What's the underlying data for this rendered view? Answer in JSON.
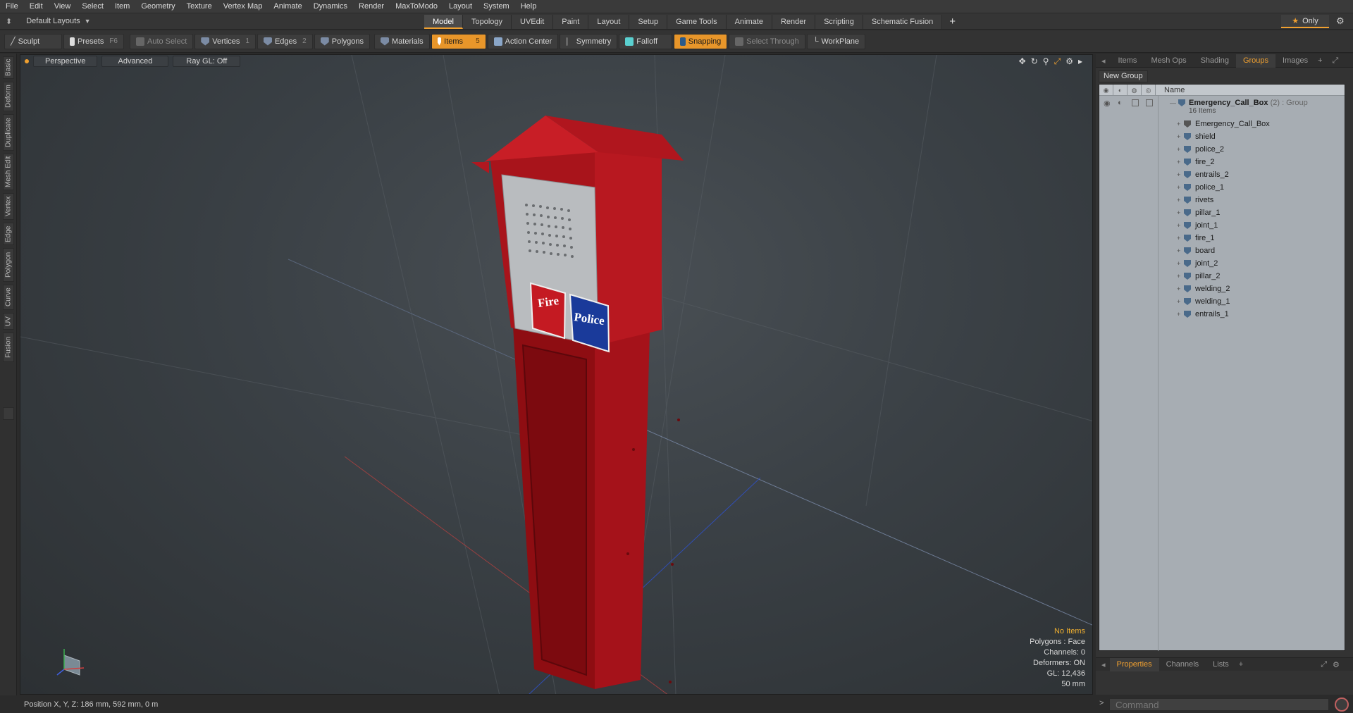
{
  "menu": [
    "File",
    "Edit",
    "View",
    "Select",
    "Item",
    "Geometry",
    "Texture",
    "Vertex Map",
    "Animate",
    "Dynamics",
    "Render",
    "MaxToModo",
    "Layout",
    "System",
    "Help"
  ],
  "layout": {
    "selector": "Default Layouts"
  },
  "tabs": [
    "Model",
    "Topology",
    "UVEdit",
    "Paint",
    "Layout",
    "Setup",
    "Game Tools",
    "Animate",
    "Render",
    "Scripting",
    "Schematic Fusion"
  ],
  "active_tab": "Model",
  "only_label": "Only",
  "toolbar": {
    "sculpt": "Sculpt",
    "presets": "Presets",
    "presets_key": "F6",
    "auto_select": "Auto Select",
    "vertices": "Vertices",
    "vertices_count": "1",
    "edges": "Edges",
    "edges_count": "2",
    "polygons": "Polygons",
    "materials": "Materials",
    "items": "Items",
    "items_count": "5",
    "action_center": "Action Center",
    "symmetry": "Symmetry",
    "falloff": "Falloff",
    "snapping": "Snapping",
    "select_through": "Select Through",
    "workplane": "WorkPlane"
  },
  "left_tabs": [
    "Basic",
    "Deform",
    "Duplicate",
    "Mesh Edit",
    "Vertex",
    "Edge",
    "Polygon",
    "Curve",
    "UV",
    "Fusion"
  ],
  "viewport": {
    "perspective": "Perspective",
    "advanced": "Advanced",
    "raygl": "Ray GL: Off",
    "sign_fire": "Fire",
    "sign_police": "Police",
    "info": {
      "no_items": "No Items",
      "polygons": "Polygons : Face",
      "channels": "Channels: 0",
      "deformers": "Deformers: ON",
      "gl": "GL: 12,436",
      "scale": "50 mm"
    }
  },
  "right_panel": {
    "tabs": [
      "Items",
      "Mesh Ops",
      "Shading",
      "Groups",
      "Images"
    ],
    "active_tab": "Groups",
    "new_group": "New Group",
    "name_header": "Name",
    "group_name": "Emergency_Call_Box",
    "group_suffix": "(2) : Group",
    "group_count": "16 Items",
    "items": [
      "Emergency_Call_Box",
      "shield",
      "police_2",
      "fire_2",
      "entrails_2",
      "police_1",
      "rivets",
      "pillar_1",
      "joint_1",
      "fire_1",
      "board",
      "joint_2",
      "pillar_2",
      "welding_2",
      "welding_1",
      "entrails_1"
    ],
    "bottom_tabs": [
      "Properties",
      "Channels",
      "Lists"
    ],
    "bottom_active": "Properties"
  },
  "status": {
    "position": "Position X, Y, Z:   186 mm, 592 mm, 0 m",
    "command_placeholder": "Command"
  },
  "colors": {
    "accent": "#f0a030",
    "box_red": "#b8141c",
    "police_blue": "#1a3a9a"
  }
}
